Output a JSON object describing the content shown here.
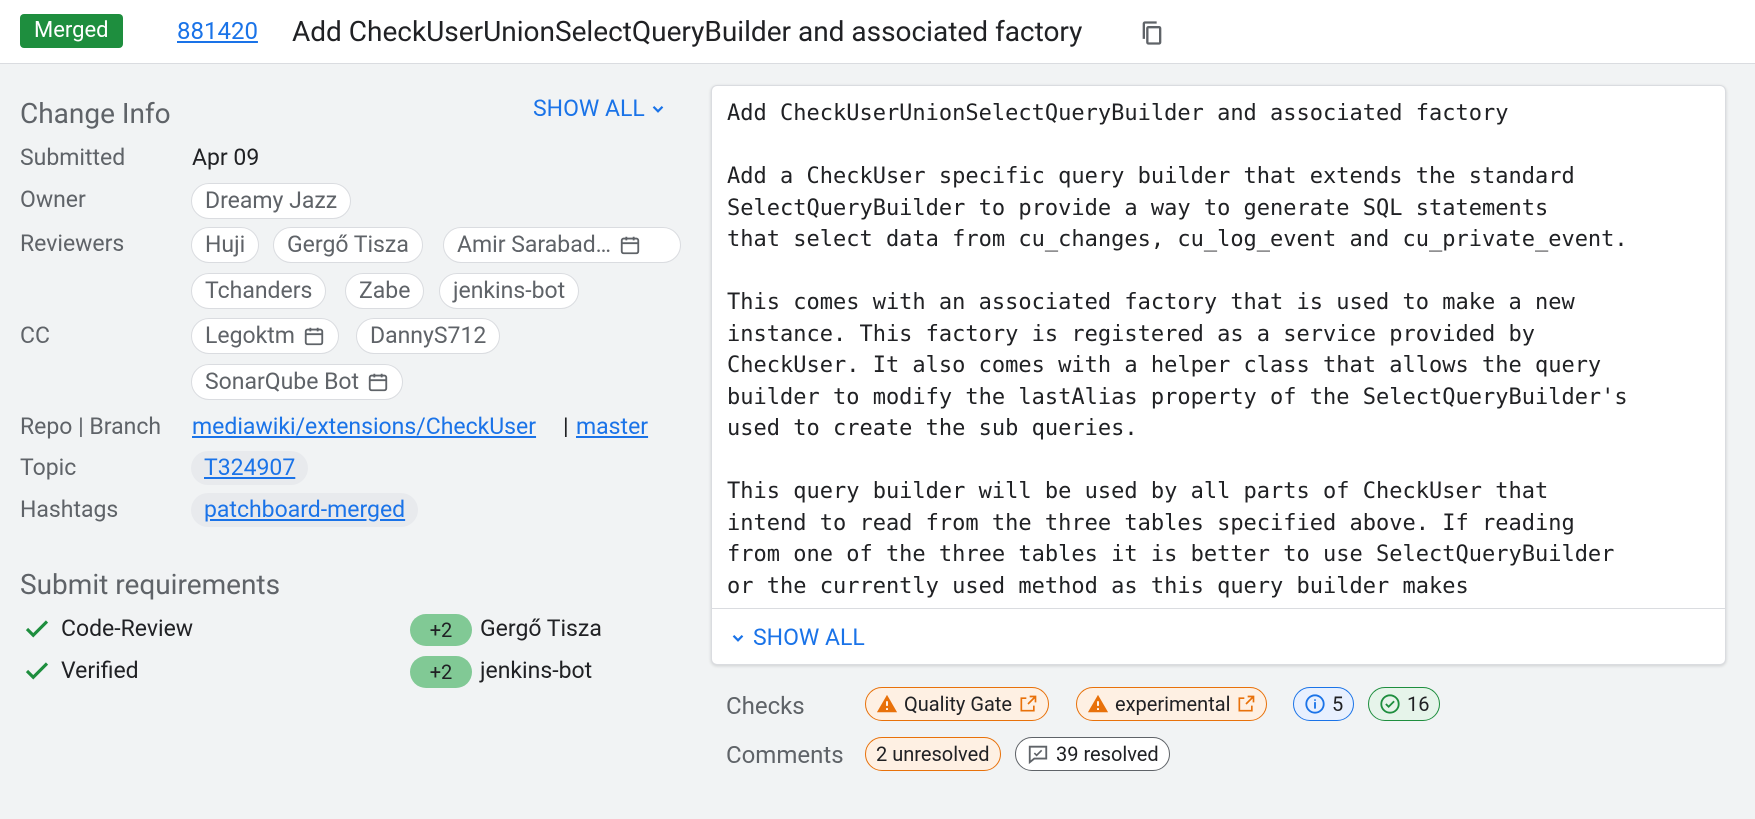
{
  "header": {
    "status": "Merged",
    "change_number": "881420",
    "title": "Add CheckUserUnionSelectQueryBuilder and associated factory"
  },
  "change_info": {
    "title": "Change Info",
    "show_all": "SHOW ALL",
    "submitted_label": "Submitted",
    "submitted_value": "Apr 09",
    "owner_label": "Owner",
    "owner": "Dreamy Jazz",
    "reviewers_label": "Reviewers",
    "reviewers": [
      "Huji",
      "Gergő Tisza",
      "Amir Sarabad…",
      "Tchanders",
      "Zabe",
      "jenkins-bot"
    ],
    "cc_label": "CC",
    "cc": [
      "Legoktm",
      "DannyS712",
      "SonarQube Bot"
    ],
    "repo_label": "Repo | Branch",
    "repo": "mediawiki/extensions/CheckUser",
    "repo_sep": "|",
    "branch": "master",
    "topic_label": "Topic",
    "topic": "T324907",
    "hashtags_label": "Hashtags",
    "hashtag": "patchboard-merged"
  },
  "submit_requirements": {
    "title": "Submit requirements",
    "items": [
      {
        "name": "Code-Review",
        "vote": "+2",
        "voter": "Gergő Tisza"
      },
      {
        "name": "Verified",
        "vote": "+2",
        "voter": "jenkins-bot"
      }
    ]
  },
  "commit_message": {
    "text": "Add CheckUserUnionSelectQueryBuilder and associated factory\n\nAdd a CheckUser specific query builder that extends the standard\nSelectQueryBuilder to provide a way to generate SQL statements\nthat select data from cu_changes, cu_log_event and cu_private_event.\n\nThis comes with an associated factory that is used to make a new\ninstance. This factory is registered as a service provided by\nCheckUser. It also comes with a helper class that allows the query\nbuilder to modify the lastAlias property of the SelectQueryBuilder's\nused to create the sub queries.\n\nThis query builder will be used by all parts of CheckUser that\nintend to read from the three tables specified above. If reading\nfrom one of the three tables it is better to use SelectQueryBuilder\nor the currently used method as this query builder makes",
    "show_all": "SHOW ALL"
  },
  "checks": {
    "label": "Checks",
    "quality_gate": "Quality Gate",
    "experimental": "experimental",
    "info_count": "5",
    "success_count": "16"
  },
  "comments": {
    "label": "Comments",
    "unresolved": "2 unresolved",
    "resolved": "39 resolved"
  },
  "colors": {
    "merged": "#1e8e3e",
    "link": "#1a73e8",
    "warning": "#e8710a",
    "vote": "#81c995"
  }
}
